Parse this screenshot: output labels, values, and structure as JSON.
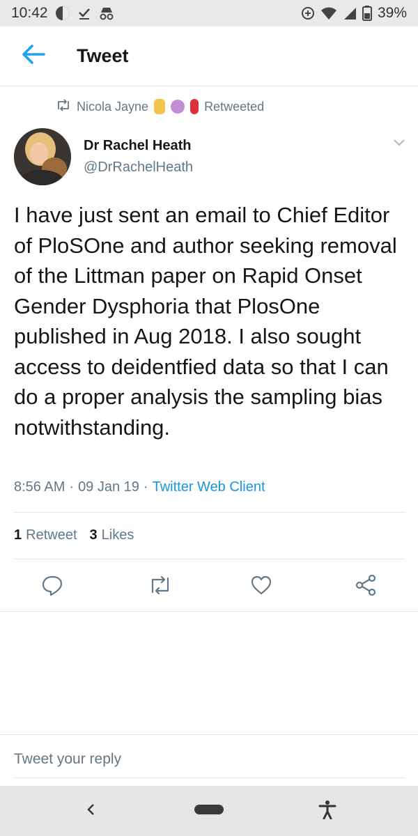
{
  "status_bar": {
    "time": "10:42",
    "battery": "39%"
  },
  "app_bar": {
    "title": "Tweet"
  },
  "retweet_context": {
    "retweeter": "Nicola Jayne",
    "label": "Retweeted"
  },
  "tweet": {
    "author_name": "Dr Rachel Heath",
    "author_handle": "@DrRachelHeath",
    "text": "I have just sent an email to Chief Editor of PloSOne and author seeking removal of the Littman paper on Rapid Onset Gender Dysphoria that PlosOne published in Aug 2018. I also sought access to deidentfied data so that I can do a proper analysis the sampling bias notwithstanding.",
    "time": "8:56 AM",
    "date": "09 Jan 19",
    "sep": "·",
    "client": "Twitter Web Client"
  },
  "stats": {
    "retweets_count": "1",
    "retweets_label": "Retweet",
    "likes_count": "3",
    "likes_label": "Likes"
  },
  "reply": {
    "placeholder": "Tweet your reply"
  },
  "colors": {
    "accent": "#1da1f2",
    "link": "#1b95e0",
    "muted": "#657786",
    "text": "#14171a"
  }
}
